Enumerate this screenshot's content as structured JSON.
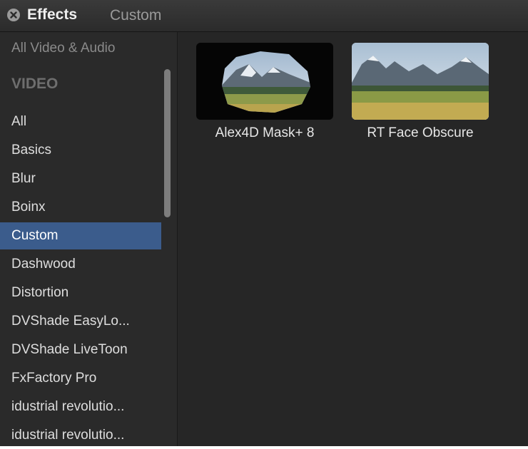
{
  "titlebar": {
    "title": "Effects",
    "subtitle": "Custom"
  },
  "sidebar": {
    "all_item": "All Video & Audio",
    "video_header": "VIDEO",
    "items": [
      {
        "label": "All"
      },
      {
        "label": "Basics"
      },
      {
        "label": "Blur"
      },
      {
        "label": "Boinx"
      },
      {
        "label": "Custom",
        "selected": true
      },
      {
        "label": "Dashwood"
      },
      {
        "label": "Distortion"
      },
      {
        "label": "DVShade EasyLo..."
      },
      {
        "label": "DVShade LiveToon"
      },
      {
        "label": "FxFactory Pro"
      },
      {
        "label": "idustrial revolutio..."
      },
      {
        "label": "idustrial revolutio..."
      }
    ]
  },
  "effects": [
    {
      "label": "Alex4D Mask+ 8",
      "icon": "masked-landscape-thumbnail"
    },
    {
      "label": "RT Face Obscure",
      "icon": "landscape-thumbnail"
    }
  ],
  "colors": {
    "selection": "#3b5c8c",
    "background": "#262626"
  }
}
